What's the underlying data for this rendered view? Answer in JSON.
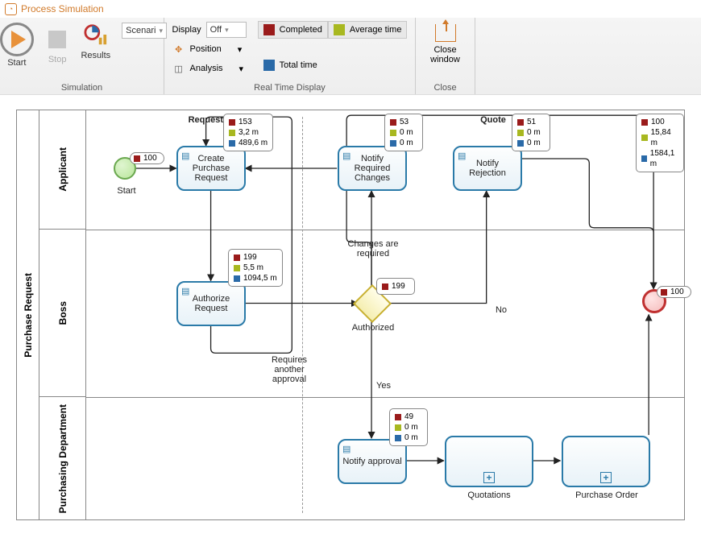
{
  "window": {
    "title": "Process Simulation"
  },
  "ribbon": {
    "simulation": {
      "label": "Simulation",
      "start": "Start",
      "stop": "Stop",
      "results": "Results",
      "scenario_value": "Scenari"
    },
    "rtd": {
      "label": "Real Time Display",
      "display_label": "Display",
      "display_value": "Off",
      "position": "Position",
      "analysis": "Analysis",
      "legend_completed": "Completed",
      "legend_avg": "Average time",
      "legend_total": "Total time"
    },
    "close": {
      "group": "Close",
      "button": "Close window"
    }
  },
  "pool": {
    "name": "Purchase Request"
  },
  "lanes": {
    "applicant": "Applicant",
    "boss": "Boss",
    "purchasing": "Purchasing Department"
  },
  "nodes": {
    "start_label": "Start",
    "create_req": "Create Purchase Request",
    "notify_changes": "Notify Required Changes",
    "notify_reject": "Notify Rejection",
    "authorize": "Authorize Request",
    "notify_approval": "Notify approval",
    "quotations": "Quotations",
    "purchase_order": "Purchase Order"
  },
  "edges": {
    "request": "Request",
    "quote": "Quote",
    "authorized": "Authorized",
    "changes_required": "Changes are required",
    "no": "No",
    "yes": "Yes",
    "requires_another": "Requires another approval"
  },
  "tips": {
    "create": {
      "c": "153",
      "a": "3,2 m",
      "t": "489,6 m"
    },
    "changes": {
      "c": "53",
      "a": "0 m",
      "t": "0 m"
    },
    "reject": {
      "c": "51",
      "a": "0 m",
      "t": "0 m"
    },
    "authorize": {
      "c": "199",
      "a": "5,5 m",
      "t": "1094,5 m"
    },
    "gateway": {
      "c": "199"
    },
    "approval": {
      "c": "49",
      "a": "0 m",
      "t": "0 m"
    },
    "end": {
      "c": "100",
      "a": "15,84 m",
      "t": "1584,1 m"
    }
  },
  "counts": {
    "start": "100",
    "end": "100"
  }
}
